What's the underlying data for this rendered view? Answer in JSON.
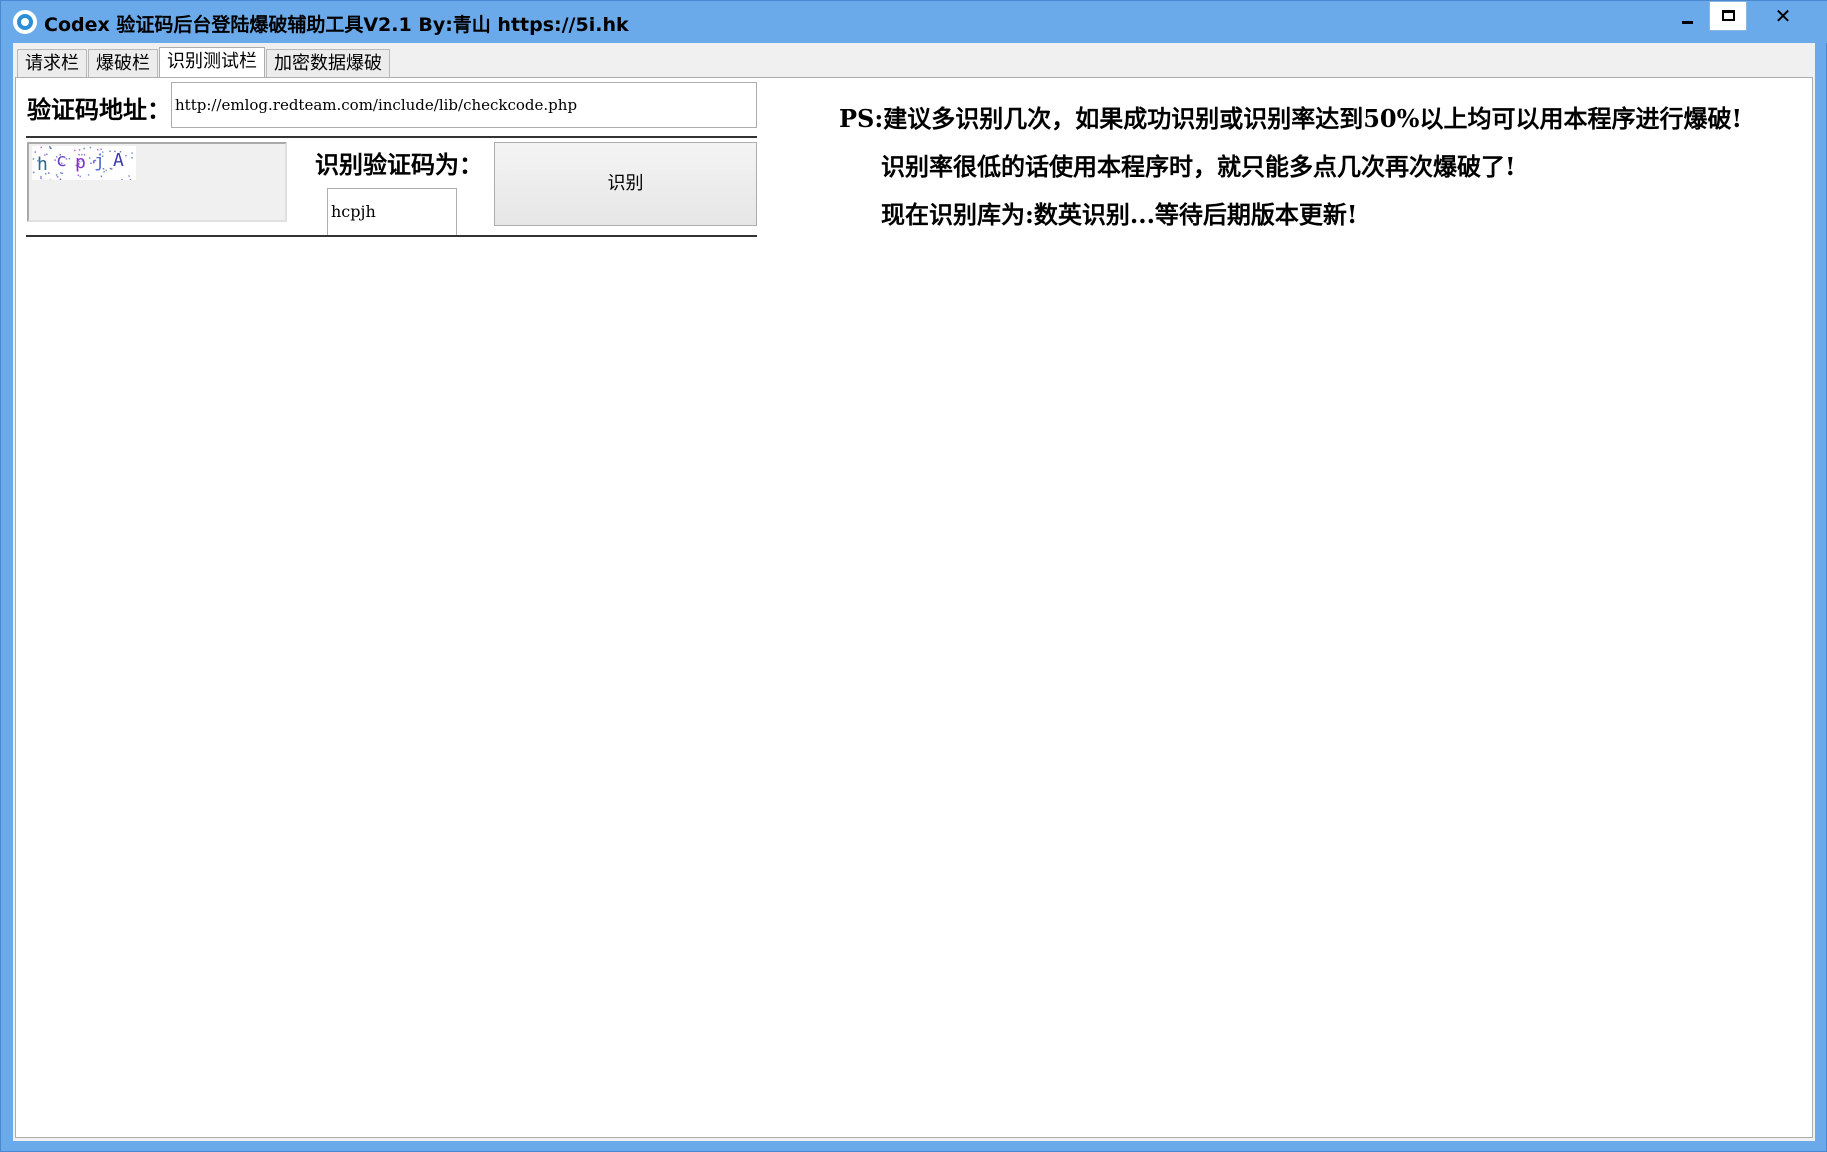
{
  "window": {
    "title": "Codex 验证码后台登陆爆破辅助工具V2.1  By:青山 https://5i.hk",
    "minimize_label": "minimize",
    "maximize_label": "maximize",
    "close_label": "✕"
  },
  "tabs": [
    {
      "label": "请求栏"
    },
    {
      "label": "爆破栏"
    },
    {
      "label": "识别测试栏",
      "active": true
    },
    {
      "label": "加密数据爆破"
    }
  ],
  "form": {
    "url_label": "验证码地址：",
    "url_value": "http://emlog.redteam.com/include/lib/checkcode.php",
    "captcha_text": "hcpjA",
    "result_label": "识别验证码为：",
    "result_value": "hcpjh",
    "recognize_button": "识别"
  },
  "notes": {
    "line1": "PS:建议多识别几次，如果成功识别或识别率达到50%以上均可以用本程序进行爆破!",
    "line2": "识别率很低的话使用本程序时，就只能多点几次再次爆破了!",
    "line3": "现在识别库为:数英识别...等待后期版本更新!"
  },
  "colors": {
    "titlebar": "#6aa9ea",
    "client_bg": "#f0f0f0",
    "panel_bg": "#ffffff"
  }
}
